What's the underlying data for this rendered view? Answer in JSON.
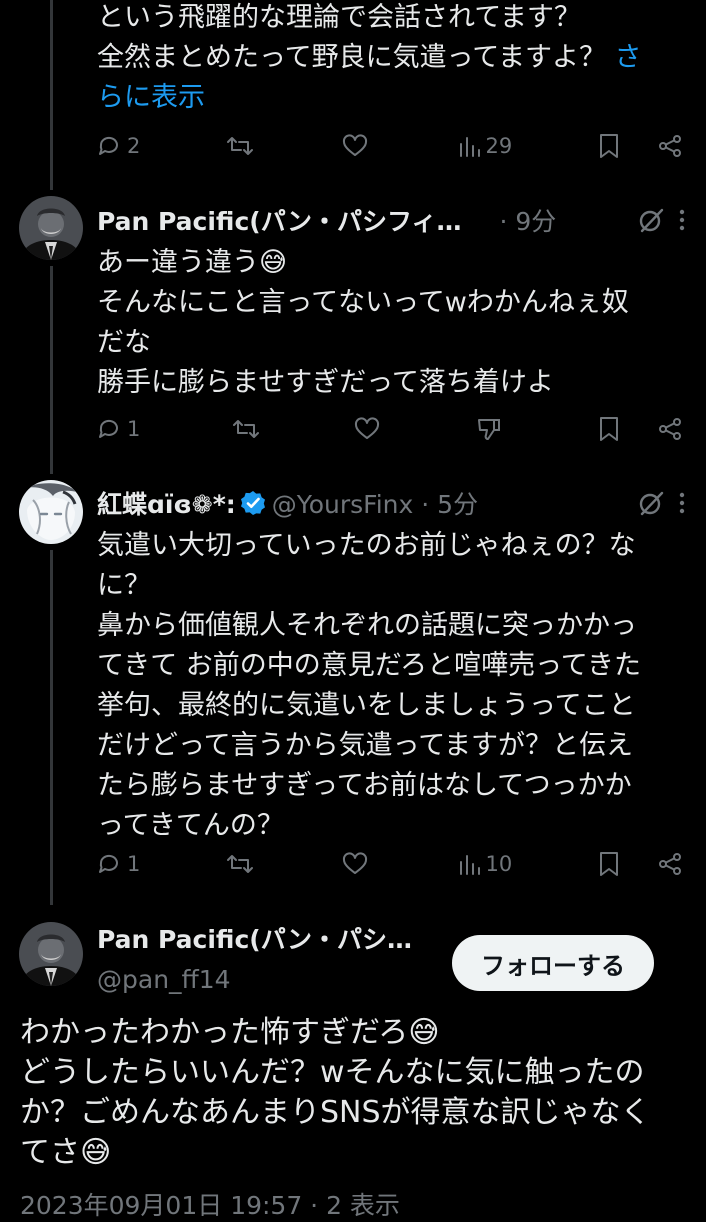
{
  "tweet1": {
    "body_line1": "という飛躍的な理論で会話されてます？",
    "body_line2": "全然まとめたって野良に気遣ってますよ？ ",
    "show_more_a": "さ",
    "show_more_b": "らに表示",
    "replies": "2",
    "views": "29",
    "icons": [
      "reply-icon",
      "retweet-icon",
      "like-icon",
      "views-icon",
      "bookmark-icon",
      "share-icon"
    ]
  },
  "tweet2": {
    "name": "Pan Pacific(パン・パシフィ…",
    "time": " · 9分",
    "body": "あー違う違う😅\nそんなにこと言ってないってwわかんねぇ奴\nだな\n勝手に膨らませすぎだって落ち着けよ",
    "replies": "1",
    "icons": [
      "grok-icon",
      "more-icon",
      "reply-icon",
      "retweet-icon",
      "like-icon",
      "dislike-icon",
      "bookmark-icon",
      "share-icon"
    ]
  },
  "tweet3": {
    "name": "紅蝶ɑïɞ❁*:",
    "handle": "@YoursFinx · 5分",
    "body": "気遣い大切っていったのお前じゃねぇの？な\nに？\n鼻から価値観人それぞれの話題に突っかかっ\nてきて お前の中の意見だろと喧嘩売ってきた\n挙句、最終的に気遣いをしましょうってこと\nだけどって言うから気遣ってますが？と伝え\nたら膨らませすぎってお前はなしてつっかか\nってきてんの？",
    "replies": "1",
    "views": "10",
    "icons": [
      "verified-icon",
      "grok-icon",
      "more-icon",
      "reply-icon",
      "retweet-icon",
      "like-icon",
      "views-icon",
      "bookmark-icon",
      "share-icon"
    ]
  },
  "main": {
    "name": "Pan Pacific(パン・パシ…",
    "handle": "@pan_ff14",
    "follow_label": "フォローする",
    "body": "わかったわかった怖すぎだろ😅\nどうしたらいいんだ？wそんなに気に触ったの\nか？ごめんなあんまりSNSが得意な訳じゃなく\nてさ😅",
    "timestamp": "2023年09月01日 19:57 · 2 表示"
  },
  "colors": {
    "background": "#000000",
    "text": "#e7e9ea",
    "muted": "#71767b",
    "accent": "#1d9bf0",
    "button_bg": "#eff3f4"
  }
}
